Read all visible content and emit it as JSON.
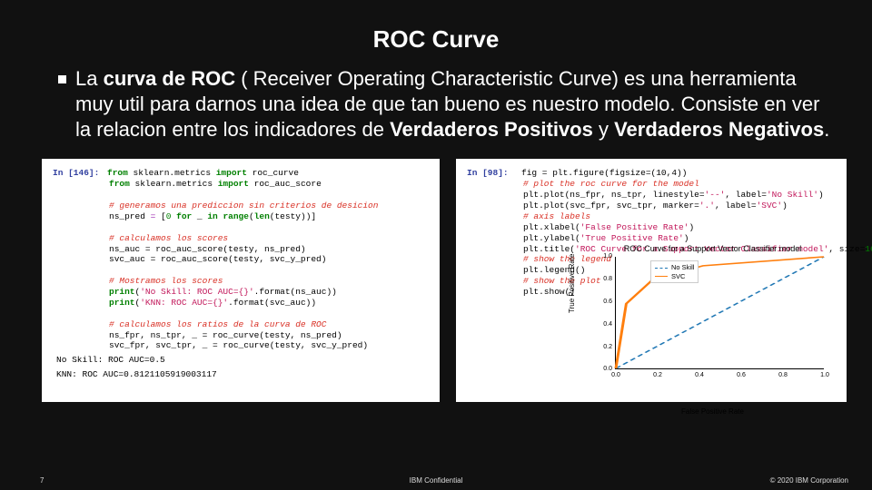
{
  "title": "ROC Curve",
  "bullet": {
    "pre": "La ",
    "bold1": "curva de ROC",
    "mid": " ( Receiver Operating Characteristic Curve) es una herramienta muy util para darnos una idea de que tan bueno es nuestro modelo. Consiste en ver la relacion entre los indicadores de ",
    "bold2": "Verdaderos Positivos",
    "mid2": " y ",
    "bold3": "Verdaderos Negativos",
    "end": "."
  },
  "left_code": {
    "prompt": "In [146]:",
    "l1a": "from",
    "l1b": " sklearn.metrics ",
    "l1c": "import",
    "l1d": " roc_curve",
    "l2a": "from",
    "l2b": " sklearn.metrics ",
    "l2c": "import",
    "l2d": " roc_auc_score",
    "c1": "# generamos una prediccion sin criterios de desicion",
    "l3a": "ns_pred ",
    "l3b": "=",
    "l3c": " [",
    "l3d": "0",
    "l3e": " ",
    "l3f": "for",
    "l3g": " _ ",
    "l3h": "in",
    "l3i": " ",
    "l3j": "range",
    "l3k": "(",
    "l3l": "len",
    "l3m": "(testy))]",
    "c2": "# calculamos los scores",
    "l4": "ns_auc = roc_auc_score(testy, ns_pred)",
    "l5": "svc_auc = roc_auc_score(testy, svc_y_pred)",
    "c3": "# Mostramos los scores",
    "l6a": "print",
    "l6b": "(",
    "l6c": "'No Skill: ROC AUC={}'",
    "l6d": ".format(ns_auc))",
    "l7a": "print",
    "l7b": "(",
    "l7c": "'KNN: ROC AUC={}'",
    "l7d": ".format(svc_auc))",
    "c4": "# calculamos los ratios de la curva de ROC",
    "l8": "ns_fpr, ns_tpr, _ = roc_curve(testy, ns_pred)",
    "l9": "svc_fpr, svc_tpr, _ = roc_curve(testy, svc_y_pred)",
    "out1": "No Skill: ROC AUC=0.5",
    "out2": "KNN: ROC AUC=0.8121105919003117"
  },
  "right_code": {
    "prompt": "In [98]:",
    "l1": "fig = plt.figure(figsize=(10,4))",
    "c1": "# plot the roc curve for the model",
    "l2a": "plt.plot(ns_fpr, ns_tpr, linestyle=",
    "l2b": "'--'",
    "l2c": ", label=",
    "l2d": "'No Skill'",
    "l2e": ")",
    "l3a": "plt.plot(svc_fpr, svc_tpr, marker=",
    "l3b": "'.'",
    "l3c": ", label=",
    "l3d": "'SVC'",
    "l3e": ")",
    "c2": "# axis labels",
    "l4a": "plt.xlabel(",
    "l4b": "'False Positive Rate'",
    "l4c": ")",
    "l5a": "plt.ylabel(",
    "l5b": "'True Positive Rate'",
    "l5c": ")",
    "l6a": "plt.title(",
    "l6b": "'ROC Curve for a Support Vector Classifier model'",
    "l6c": ", size=",
    "l6d": "16",
    "l6e": ")",
    "c3": "# show the legend",
    "l7": "plt.legend()",
    "c4": "# show the plot",
    "l8": "plt.show()"
  },
  "chart_data": {
    "type": "line",
    "title": "ROC Curve for a Support Vector Classifier model",
    "xlabel": "False Positive Rate",
    "ylabel": "True Positive Rate",
    "xlim": [
      0.0,
      1.0
    ],
    "ylim": [
      0.0,
      1.0
    ],
    "xticks": [
      0.0,
      0.2,
      0.4,
      0.6,
      0.8,
      1.0
    ],
    "yticks": [
      0.0,
      0.2,
      0.4,
      0.6,
      0.8,
      1.0
    ],
    "series": [
      {
        "name": "No Skill",
        "style": "dashed",
        "color": "#1f77b4",
        "x": [
          0.0,
          1.0
        ],
        "y": [
          0.0,
          1.0
        ]
      },
      {
        "name": "SVC",
        "style": "solid",
        "color": "#ff7f0e",
        "x": [
          0.0,
          0.05,
          0.18,
          0.42,
          1.0
        ],
        "y": [
          0.0,
          0.58,
          0.8,
          0.92,
          1.0
        ]
      }
    ]
  },
  "footer": {
    "page": "7",
    "mid": "IBM Confidential",
    "right": "© 2020 IBM Corporation"
  }
}
